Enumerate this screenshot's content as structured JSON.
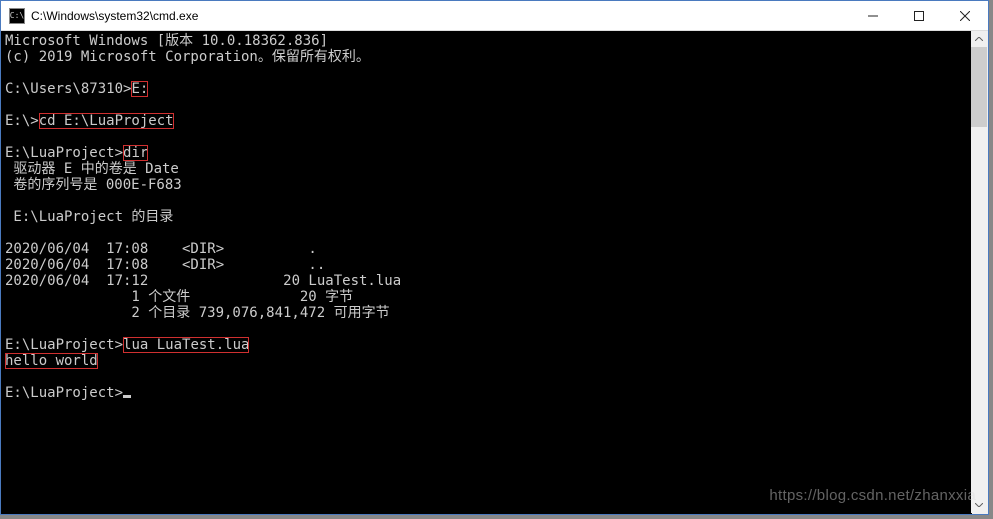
{
  "window": {
    "icon_label": "C:\\",
    "title": "C:\\Windows\\system32\\cmd.exe"
  },
  "terminal": {
    "line_version": "Microsoft Windows [版本 10.0.18362.836]",
    "line_copyright": "(c) 2019 Microsoft Corporation。保留所有权利。",
    "prompt1_prefix": "C:\\Users\\87310>",
    "cmd1": "E:",
    "prompt2_prefix": "E:\\>",
    "cmd2": "cd E:\\LuaProject",
    "prompt3_prefix": "E:\\LuaProject>",
    "cmd3": "dir",
    "dir_volume": " 驱动器 E 中的卷是 Date",
    "dir_serial": " 卷的序列号是 000E-F683",
    "dir_of": " E:\\LuaProject 的目录",
    "dir_row1": "2020/06/04  17:08    <DIR>          .",
    "dir_row2": "2020/06/04  17:08    <DIR>          ..",
    "dir_row3": "2020/06/04  17:12                20 LuaTest.lua",
    "dir_summary1": "               1 个文件             20 字节",
    "dir_summary2": "               2 个目录 739,076,841,472 可用字节",
    "prompt4_prefix": "E:\\LuaProject>",
    "cmd4": "lua LuaTest.lua",
    "output_hello": "hello world",
    "prompt5_prefix": "E:\\LuaProject>"
  },
  "watermark": "https://blog.csdn.net/zhanxxia"
}
